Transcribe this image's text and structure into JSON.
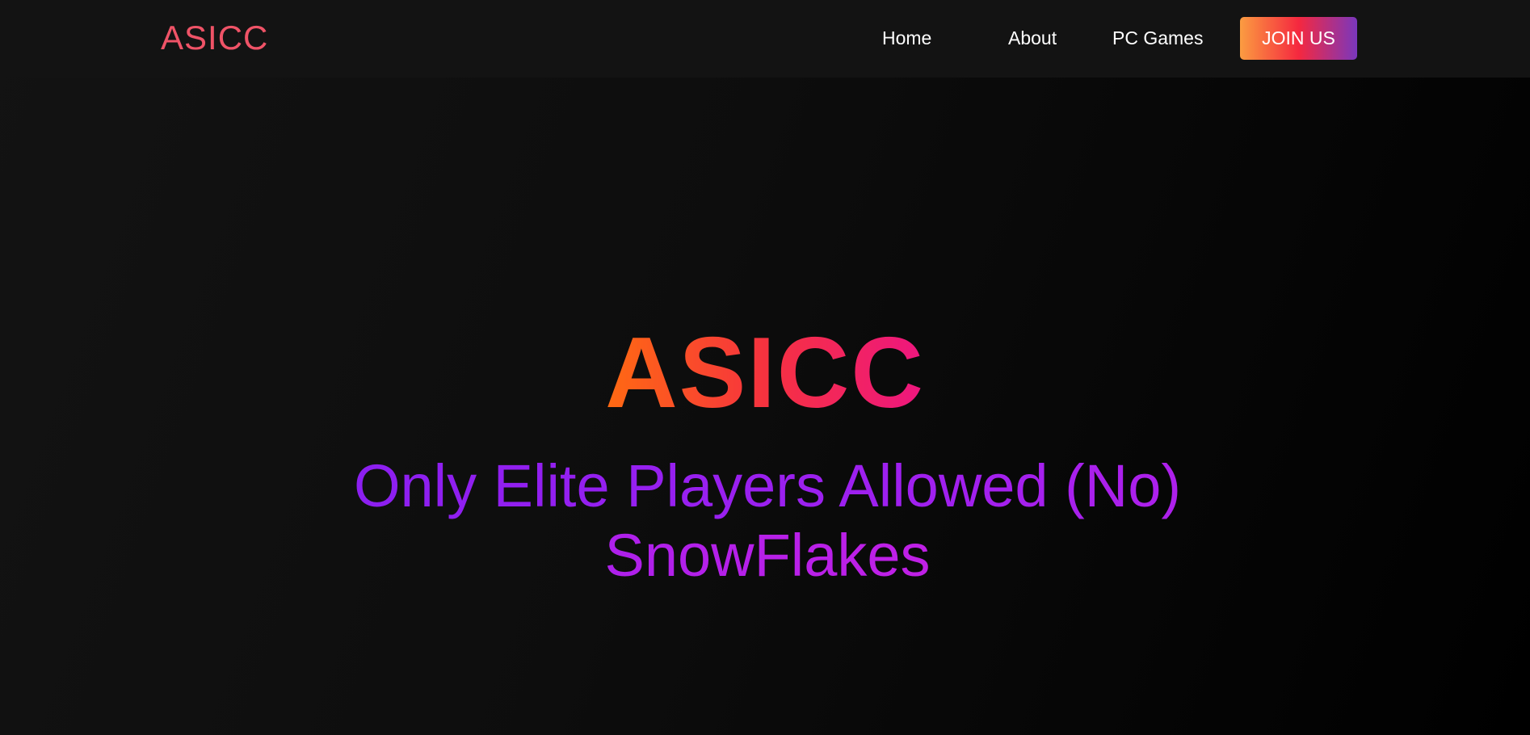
{
  "nav": {
    "logo": "ASICC",
    "links": [
      {
        "label": "Home"
      },
      {
        "label": "About"
      },
      {
        "label": "PC Games"
      }
    ],
    "cta_label": "JOIN US"
  },
  "hero": {
    "title": "ASICC",
    "subtitle": "Only Elite Players Allowed (No) SnowFlakes"
  },
  "colors": {
    "logo": "#ef5367",
    "title_gradient": [
      "#ff6a12",
      "#f6323f",
      "#ee1680"
    ],
    "subtitle_gradient": [
      "#8c1ff0",
      "#a020ef",
      "#c020e6"
    ],
    "cta_gradient": [
      "#fb9c41",
      "#f5283f",
      "#7a37bd"
    ]
  }
}
